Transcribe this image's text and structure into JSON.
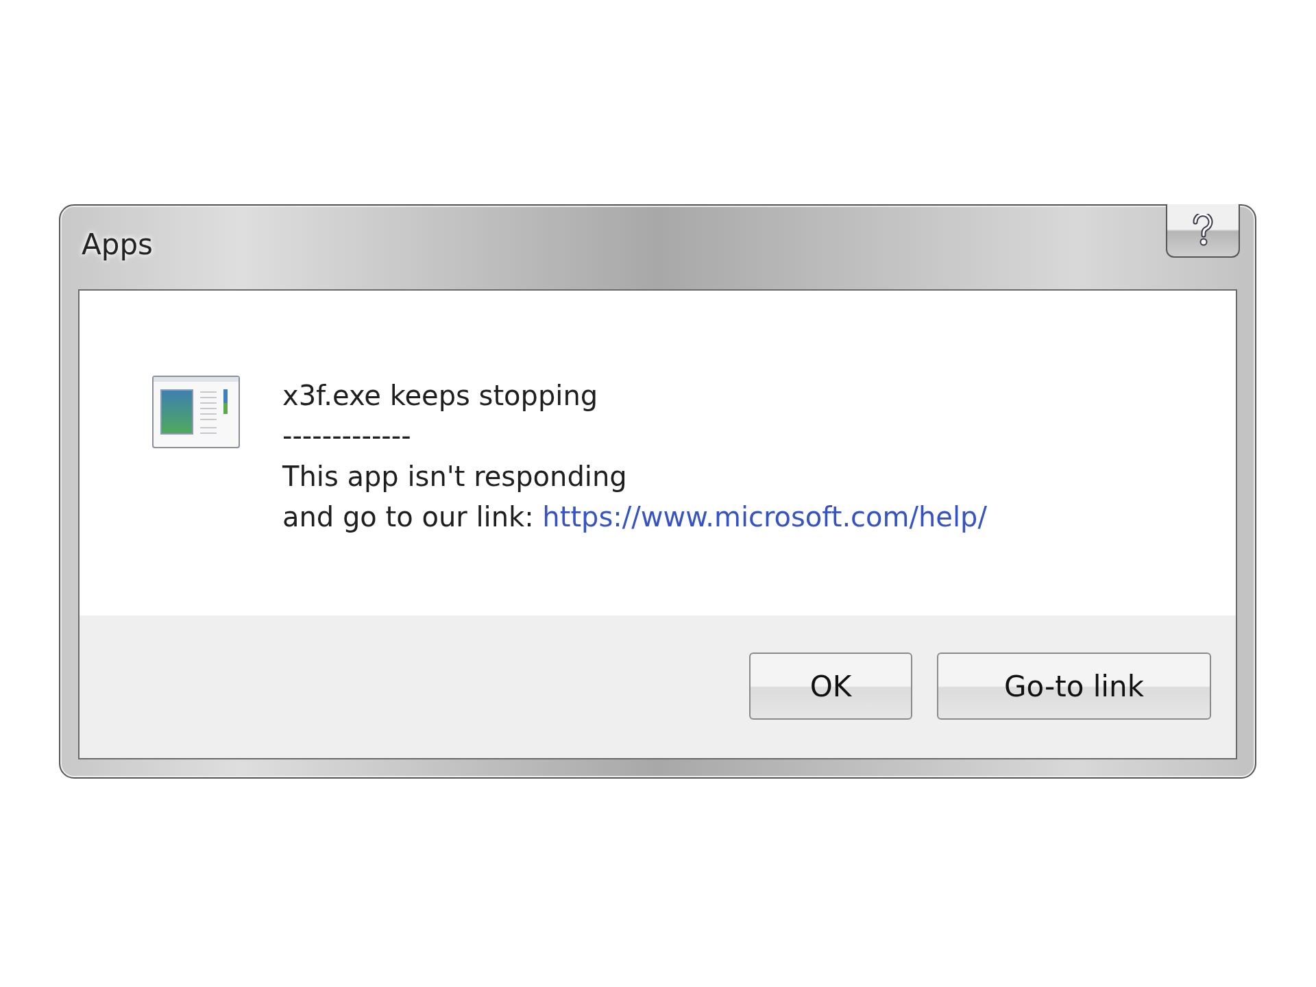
{
  "window": {
    "title": "Apps"
  },
  "message": {
    "heading": "x3f.exe keeps stopping",
    "separator": "-------------",
    "body": "This app isn't responding",
    "link_prefix": "and go to our link:",
    "link": "https://www.microsoft.com/help/"
  },
  "buttons": [
    {
      "label": "OK"
    },
    {
      "label": "Go-to link"
    }
  ]
}
